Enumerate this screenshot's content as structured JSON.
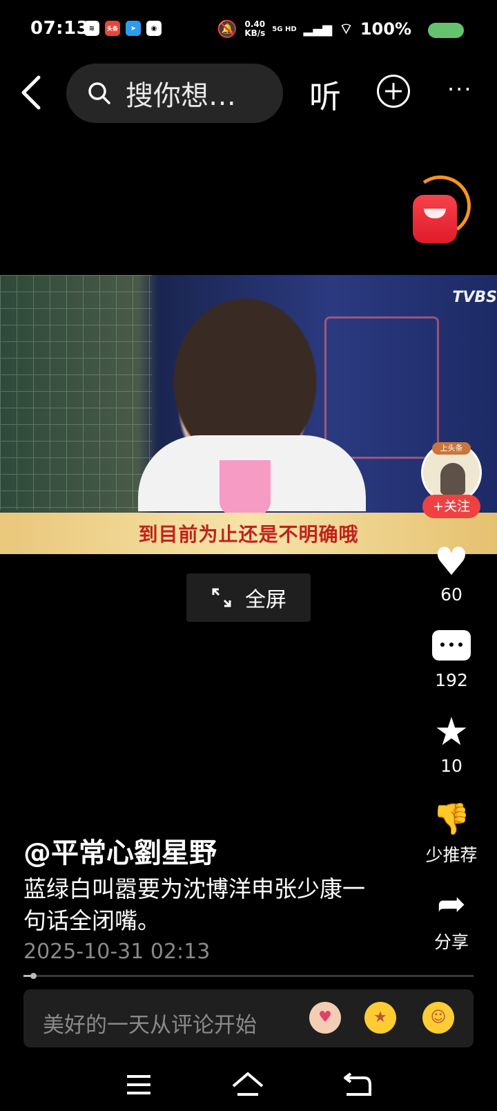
{
  "status_bar": {
    "time": "07:13",
    "netspeed_value": "0.40",
    "netspeed_unit": "KB/s",
    "network": "5G HD",
    "battery_percent": "100%",
    "battery_level": 1.0,
    "app_icons": [
      "wifi-app-icon",
      "toutiao-icon",
      "telegram-icon",
      "camera-icon"
    ]
  },
  "top_bar": {
    "search_placeholder": "搜你想…",
    "listen_label": "听",
    "more_label": "···"
  },
  "video": {
    "watermark": "TVBS",
    "caption": "到目前为止还是不明确哦",
    "fullscreen_label": "全屏"
  },
  "author_panel": {
    "badge": "上头条",
    "follow_label": "+关注"
  },
  "actions": {
    "likes": "60",
    "comments": "192",
    "favorites": "10",
    "dislike_label": "少推荐",
    "share_label": "分享"
  },
  "post": {
    "author": "@平常心劉星野",
    "description": "蓝绿白叫嚣要为沈博洋申张少康一句话全闭嘴。",
    "date": "2025-10-31 02:13",
    "progress": 0.02
  },
  "comment": {
    "placeholder": "美好的一天从评论开始"
  },
  "colors": {
    "background": "#000000",
    "accent_red": "#f04142",
    "caption_text": "#c0221c",
    "battery": "#63c46d"
  }
}
